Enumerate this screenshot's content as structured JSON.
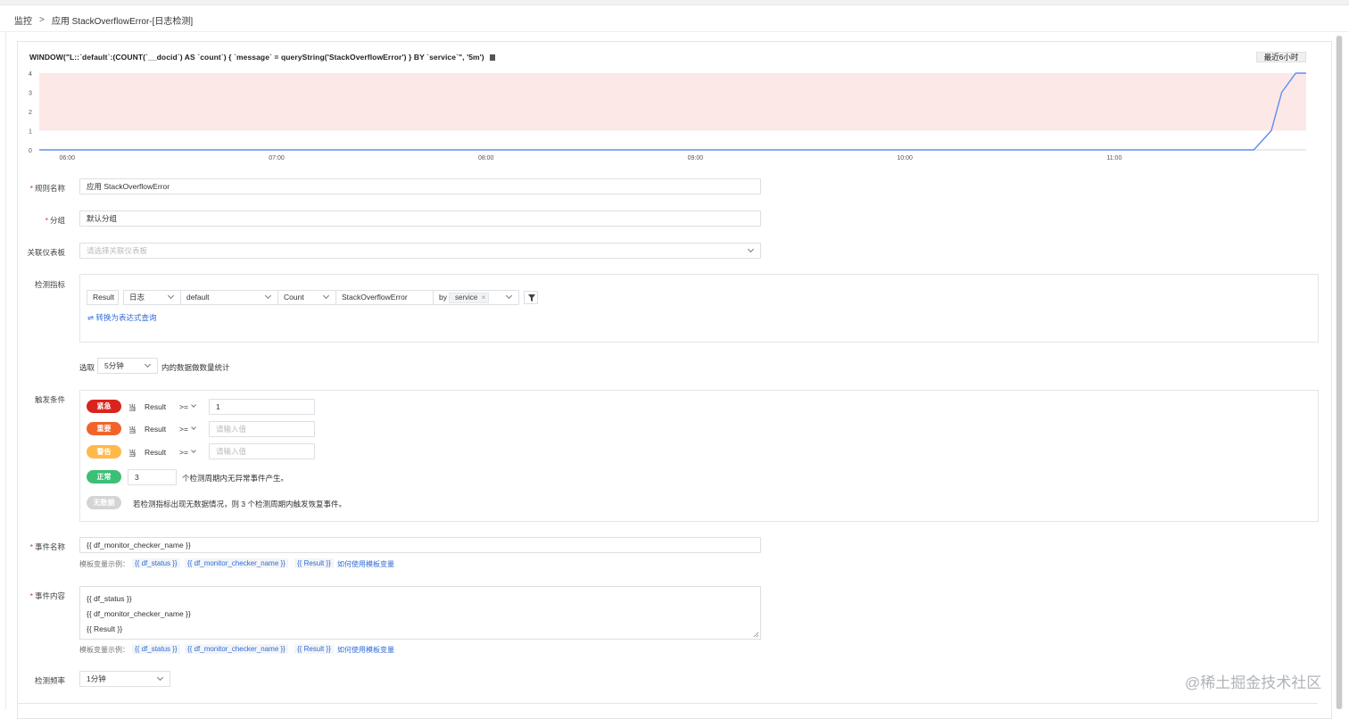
{
  "breadcrumb": {
    "parent": "监控",
    "separator": ">",
    "current": "应用 StackOverflowError-[日志检测]"
  },
  "query": {
    "text": "WINDOW(\"L::`default`:(COUNT(`__docid`) AS `count`) { `message` = queryString('StackOverflowError') } BY `service`\", '5m')"
  },
  "time_range": "最近6小时",
  "chart_data": {
    "type": "line",
    "x": [
      "05:52",
      "06:00",
      "07:00",
      "08:00",
      "09:00",
      "10:00",
      "11:00",
      "11:40",
      "11:45",
      "11:48",
      "11:52",
      "11:55"
    ],
    "series": [
      {
        "values": [
          0,
          0,
          0,
          0,
          0,
          0,
          0,
          0,
          1,
          3,
          4,
          4
        ]
      }
    ],
    "xticks": [
      "06:00",
      "07:00",
      "08:00",
      "09:00",
      "10:00",
      "11:00"
    ],
    "yticks": [
      0,
      1,
      2,
      3,
      4
    ],
    "ylim": [
      0,
      4
    ],
    "threshold_band": [
      1,
      4
    ],
    "colors": {
      "line": "#5b8ff0",
      "band": "#fde8e8"
    }
  },
  "rule_name": {
    "label": "规则名称",
    "value": "应用 StackOverflowError"
  },
  "group": {
    "label": "分组",
    "value": "默认分组"
  },
  "dashboard": {
    "label": "关联仪表板",
    "placeholder": "请选择关联仪表板"
  },
  "metric": {
    "label": "检测指标",
    "result": "Result",
    "source": "日志",
    "index": "default",
    "agg": "Count",
    "keyword": "StackOverflowError",
    "by": "by",
    "by_tag": "service",
    "tag_close": "×",
    "convert_link": "⇌ 转换为表达式查询"
  },
  "window": {
    "prefix": "选取",
    "value": "5分钟",
    "suffix": "内的数据做数量统计"
  },
  "trigger": {
    "label": "触发条件",
    "when": "当",
    "result": "Result",
    "op": ">=",
    "levels": [
      {
        "name": "紧急",
        "value": "1",
        "placeholder": "",
        "color": "#d9241d"
      },
      {
        "name": "重要",
        "value": "",
        "placeholder": "请输入值",
        "color": "#f0642c"
      },
      {
        "name": "警告",
        "value": "",
        "placeholder": "请输入值",
        "color": "#ffb84a"
      }
    ],
    "normal": {
      "name": "正常",
      "value": "3",
      "text": "个检测周期内无异常事件产生。",
      "color": "#3dbf76"
    },
    "nodata": {
      "name": "无数据",
      "text": "若检测指标出现无数据情况，则 3 个检测周期内触发恢复事件。",
      "color": "#d4d4d4"
    }
  },
  "event_name": {
    "label": "事件名称",
    "value": "{{ df_monitor_checker_name }}"
  },
  "template_hint": {
    "prefix": "模板变量示例：",
    "vars": [
      "{{ df_status }}",
      "{{ df_monitor_checker_name }}",
      "{{ Result }}"
    ],
    "help": "如何使用模板变量"
  },
  "event_content": {
    "label": "事件内容",
    "lines": [
      "{{ df_status }}",
      "{{ df_monitor_checker_name }}",
      "{{ Result }}"
    ]
  },
  "frequency": {
    "label": "检测频率",
    "value": "1分钟"
  },
  "watermark": "@稀土掘金技术社区"
}
